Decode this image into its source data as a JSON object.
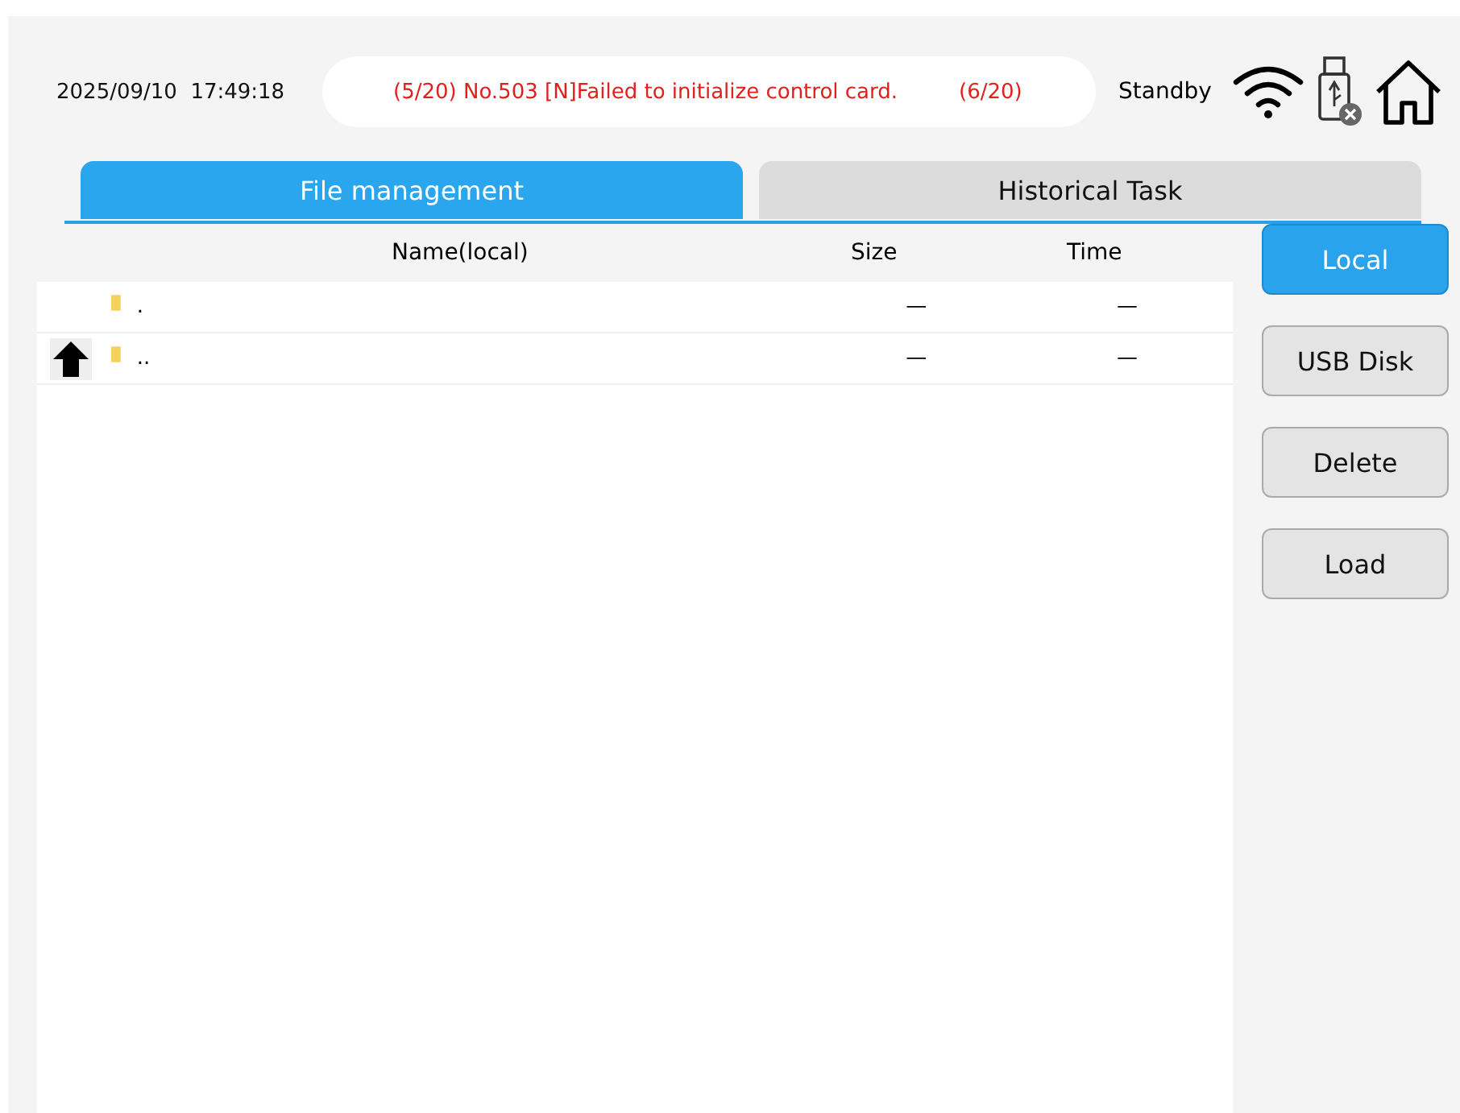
{
  "header": {
    "datetime": "2025/09/10  17:49:18",
    "messages": [
      "(5/20) No.503 [N]Failed to initialize control card.",
      "(6/20)"
    ],
    "status": "Standby"
  },
  "tabs": [
    {
      "label": "File management",
      "selected": true
    },
    {
      "label": "Historical Task",
      "selected": false
    }
  ],
  "table": {
    "columns": [
      "Name(local)",
      "Size",
      "Time"
    ],
    "rows": [
      {
        "kind": "current",
        "name": ".",
        "size": "—",
        "time": "—"
      },
      {
        "kind": "parent",
        "name": "..",
        "size": "—",
        "time": "—"
      }
    ]
  },
  "buttons": [
    {
      "label": "Local",
      "selected": true
    },
    {
      "label": "USB Disk",
      "selected": false
    },
    {
      "label": "Delete",
      "selected": false
    },
    {
      "label": "Load",
      "selected": false
    }
  ]
}
